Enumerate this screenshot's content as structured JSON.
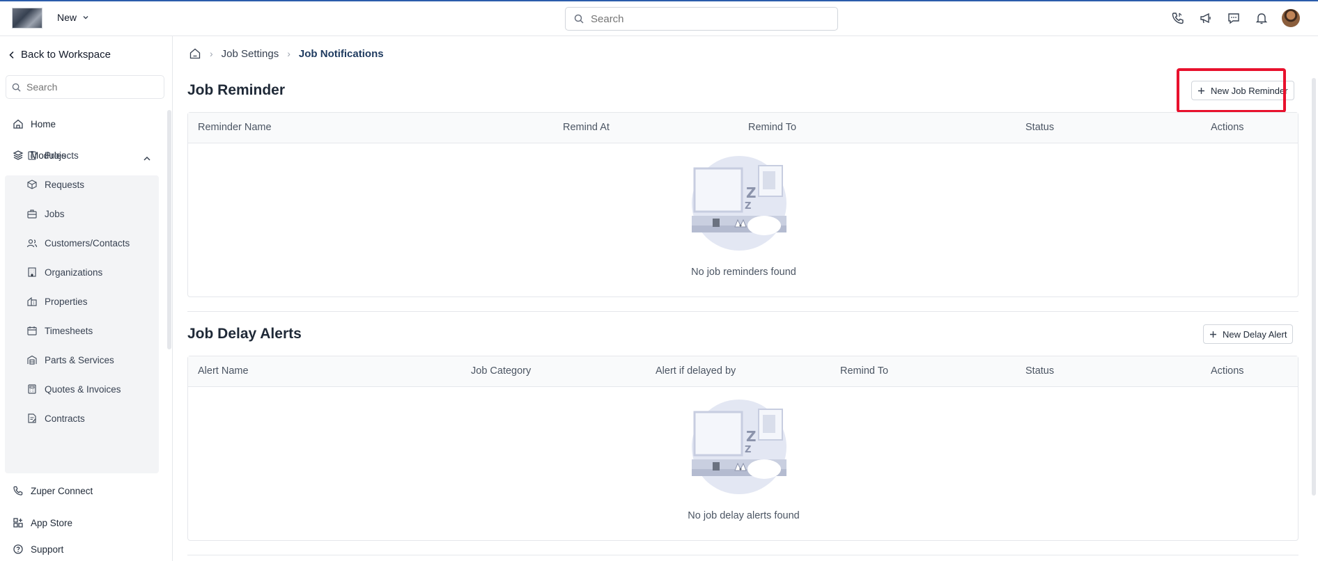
{
  "topbar": {
    "new_label": "New",
    "search_placeholder": "Search"
  },
  "sidebar": {
    "back_label": "Back to Workspace",
    "search_placeholder": "Search",
    "home_label": "Home",
    "modules_label": "Modules",
    "modules": [
      {
        "label": "Projects",
        "icon": "clipboard-icon"
      },
      {
        "label": "Requests",
        "icon": "box-icon"
      },
      {
        "label": "Jobs",
        "icon": "briefcase-icon"
      },
      {
        "label": "Customers/Contacts",
        "icon": "users-icon"
      },
      {
        "label": "Organizations",
        "icon": "building-icon"
      },
      {
        "label": "Properties",
        "icon": "property-icon"
      },
      {
        "label": "Timesheets",
        "icon": "calendar-icon"
      },
      {
        "label": "Parts & Services",
        "icon": "warehouse-icon"
      },
      {
        "label": "Quotes & Invoices",
        "icon": "calculator-icon"
      },
      {
        "label": "Contracts",
        "icon": "contract-icon"
      }
    ],
    "connect_label": "Zuper Connect",
    "appstore_label": "App Store",
    "support_label": "Support"
  },
  "breadcrumb": {
    "level1": "Job Settings",
    "current": "Job Notifications"
  },
  "reminder": {
    "title": "Job Reminder",
    "button_label": "New Job Reminder",
    "columns": [
      "Reminder Name",
      "Remind At",
      "Remind To",
      "Status",
      "Actions"
    ],
    "empty_text": "No job reminders found"
  },
  "delay": {
    "title": "Job Delay Alerts",
    "button_label": "New Delay Alert",
    "columns": [
      "Alert Name",
      "Job Category",
      "Alert if delayed by",
      "Remind To",
      "Status",
      "Actions"
    ],
    "empty_text": "No job delay alerts found"
  },
  "colors": {
    "accent": "#2b5cab",
    "highlight": "#e8112d",
    "module_bg": "#f3f4f6"
  }
}
